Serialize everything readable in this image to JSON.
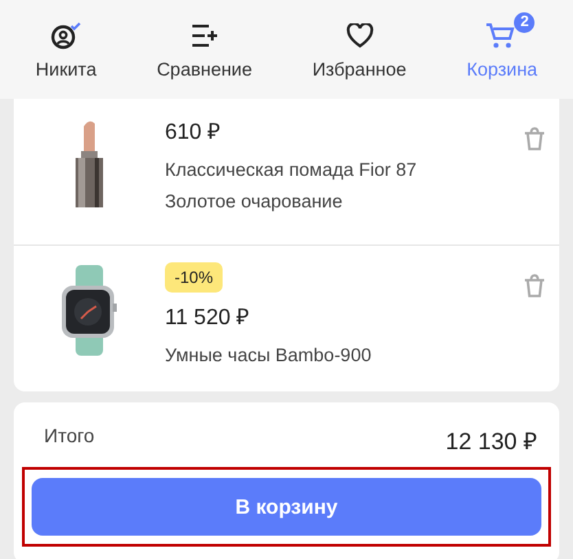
{
  "nav": [
    {
      "label": "Никита",
      "kind": "user",
      "selected": false
    },
    {
      "label": "Сравнение",
      "kind": "compare",
      "selected": false
    },
    {
      "label": "Избранное",
      "kind": "heart",
      "selected": false
    },
    {
      "label": "Корзина",
      "kind": "cart",
      "selected": true,
      "badge": "2"
    }
  ],
  "items": [
    {
      "kind": "lipstick",
      "price": "610 ₽",
      "name": "Классическая помада Fior 87 Золотое очарование"
    },
    {
      "kind": "watch",
      "discount": "-10%",
      "price": "11 520 ₽",
      "name": "Умные часы Bambo-900"
    }
  ],
  "total": {
    "label": "Итого",
    "value": "12 130 ₽"
  },
  "button": {
    "label": "В корзину",
    "highlighted": true
  }
}
